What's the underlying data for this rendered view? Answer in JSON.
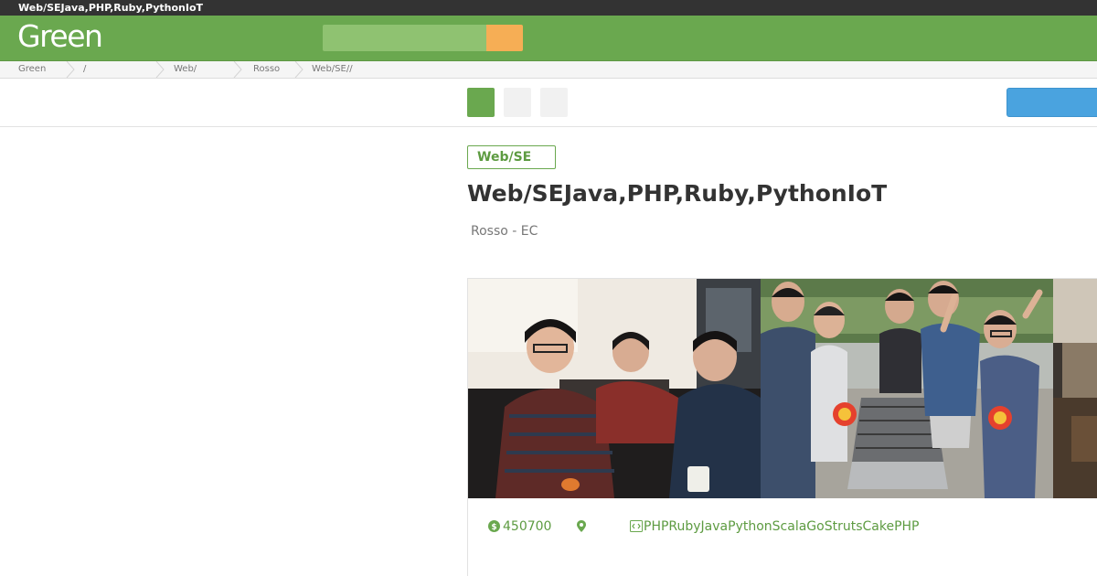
{
  "topbar": {
    "title": "Web/SEJava,PHP,Ruby,PythonIoT"
  },
  "header": {
    "logo_text": "Green",
    "search": {
      "value": "",
      "placeholder": ""
    }
  },
  "breadcrumb": {
    "items": [
      {
        "label": "Green"
      },
      {
        "label": "/"
      },
      {
        "label": "Web/"
      },
      {
        "label": "Rosso"
      },
      {
        "label": "Web/SE//"
      }
    ]
  },
  "tabs": {
    "active_index": 0,
    "count": 3
  },
  "job": {
    "category_tag": "Web/SE",
    "title": "Web/SEJava,PHP,Ruby,PythonIoT",
    "company_line": "Rosso - EC",
    "salary": "450700",
    "location": "",
    "skills": "PHPRubyJavaPythonScalaGoStrutsCakePHP"
  },
  "colors": {
    "brand_green": "#6aa84f",
    "search_button": "#f6ae55",
    "apply_button": "#4aa3df",
    "topbar": "#333333"
  },
  "icons": {
    "salary": "yen-coin-icon",
    "location": "map-pin-icon",
    "skills": "code-icon",
    "search": "search-icon"
  }
}
